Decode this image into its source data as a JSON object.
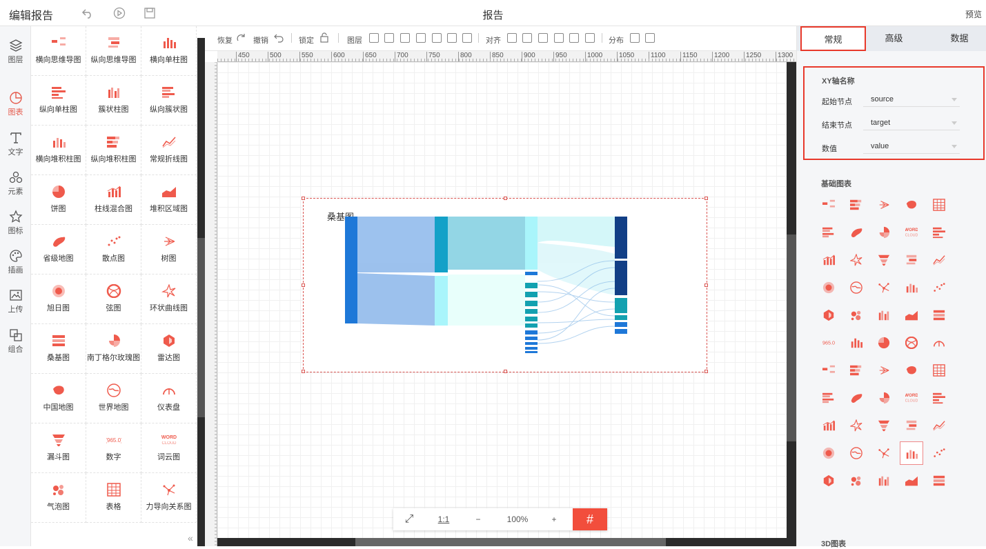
{
  "topbar": {
    "title": "编辑报告",
    "center_title": "报告",
    "preview_label": "预览"
  },
  "leftnav": {
    "items": [
      {
        "label": "图层",
        "icon": "layers-icon"
      },
      {
        "label": "图表",
        "icon": "chart-icon",
        "active": true
      },
      {
        "label": "文字",
        "icon": "text-icon"
      },
      {
        "label": "元素",
        "icon": "elements-icon"
      },
      {
        "label": "图标",
        "icon": "star-icon"
      },
      {
        "label": "插画",
        "icon": "palette-icon"
      },
      {
        "label": "上传",
        "icon": "upload-icon"
      },
      {
        "label": "组合",
        "icon": "group-icon"
      }
    ]
  },
  "palette": {
    "items": [
      {
        "label": "横向思维导图"
      },
      {
        "label": "纵向思维导图"
      },
      {
        "label": "横向单柱图"
      },
      {
        "label": "纵向单柱图"
      },
      {
        "label": "簇状柱图"
      },
      {
        "label": "纵向簇状图"
      },
      {
        "label": "横向堆积柱图"
      },
      {
        "label": "纵向堆积柱图"
      },
      {
        "label": "常规折线图"
      },
      {
        "label": "饼图"
      },
      {
        "label": "柱线混合图"
      },
      {
        "label": "堆积区域图"
      },
      {
        "label": "省级地图"
      },
      {
        "label": "散点图"
      },
      {
        "label": "树图"
      },
      {
        "label": "旭日图"
      },
      {
        "label": "弦图"
      },
      {
        "label": "环状曲线图"
      },
      {
        "label": "桑基图"
      },
      {
        "label": "南丁格尔玫瑰图"
      },
      {
        "label": "雷达图"
      },
      {
        "label": "中国地图"
      },
      {
        "label": "世界地图"
      },
      {
        "label": "仪表盘"
      },
      {
        "label": "漏斗图"
      },
      {
        "label": "数字"
      },
      {
        "label": "词云图"
      },
      {
        "label": "气泡图"
      },
      {
        "label": "表格"
      },
      {
        "label": "力导向关系图"
      }
    ]
  },
  "toolbar": {
    "redo": "恢复",
    "undo": "撤销",
    "lock": "锁定",
    "layer": "图层",
    "align": "对齐",
    "distribute": "分布"
  },
  "ruler": {
    "h_ticks": [
      "450",
      "500",
      "550",
      "600",
      "650",
      "700",
      "750",
      "800",
      "850",
      "900",
      "950",
      "1000",
      "1050",
      "1100",
      "1150",
      "1200",
      "1250",
      "1300"
    ]
  },
  "canvas": {
    "chart_title": "桑基图"
  },
  "zoombar": {
    "fit_label": "⤢",
    "one_to_one": "1:1",
    "minus": "−",
    "zoom": "100%",
    "plus": "+",
    "grid": "#"
  },
  "rpanel": {
    "tabs": [
      {
        "label": "常规",
        "active": true
      },
      {
        "label": "高级"
      },
      {
        "label": "数据"
      }
    ],
    "xy_title": "XY轴名称",
    "fields": [
      {
        "label": "起始节点",
        "value": "source"
      },
      {
        "label": "结束节点",
        "value": "target"
      },
      {
        "label": "数值",
        "value": "value"
      }
    ],
    "basic_title": "基础图表",
    "threed_title": "3D图表"
  },
  "colors": {
    "accent": "#e8382a",
    "chart_red": "#ef5a4c",
    "sankey_dark": "#123f86",
    "sankey_blue": "#1e78d8",
    "sankey_teal": "#13a1b0"
  }
}
